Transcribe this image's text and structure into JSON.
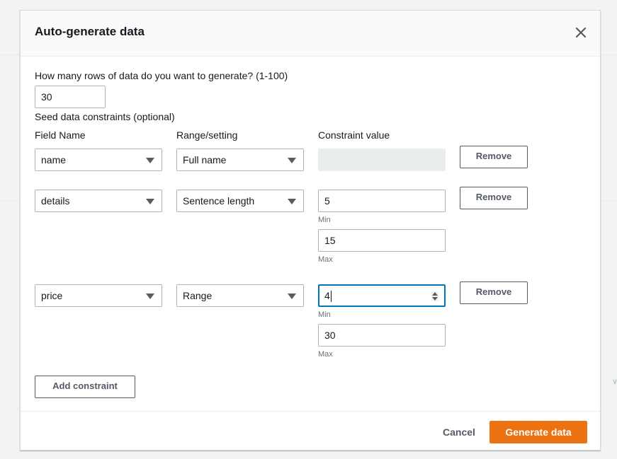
{
  "modal": {
    "title": "Auto-generate data",
    "close_icon": "close-icon"
  },
  "rows_question": {
    "label": "How many rows of data do you want to generate? (1-100)",
    "value": "30"
  },
  "constraints": {
    "section_label": "Seed data constraints (optional)",
    "headers": {
      "field_name": "Field Name",
      "range_setting": "Range/setting",
      "constraint_value": "Constraint value"
    },
    "rows": [
      {
        "field": "name",
        "setting": "Full name",
        "value_disabled": true,
        "remove_label": "Remove"
      },
      {
        "field": "details",
        "setting": "Sentence length",
        "min_value": "5",
        "min_label": "Min",
        "max_value": "15",
        "max_label": "Max",
        "remove_label": "Remove"
      },
      {
        "field": "price",
        "setting": "Range",
        "min_value": "4",
        "min_label": "Min",
        "max_value": "30",
        "max_label": "Max",
        "remove_label": "Remove",
        "min_focused": true
      }
    ],
    "add_label": "Add constraint"
  },
  "footer": {
    "cancel_label": "Cancel",
    "generate_label": "Generate data"
  },
  "colors": {
    "primary": "#ec7211",
    "focus": "#0073bb"
  }
}
